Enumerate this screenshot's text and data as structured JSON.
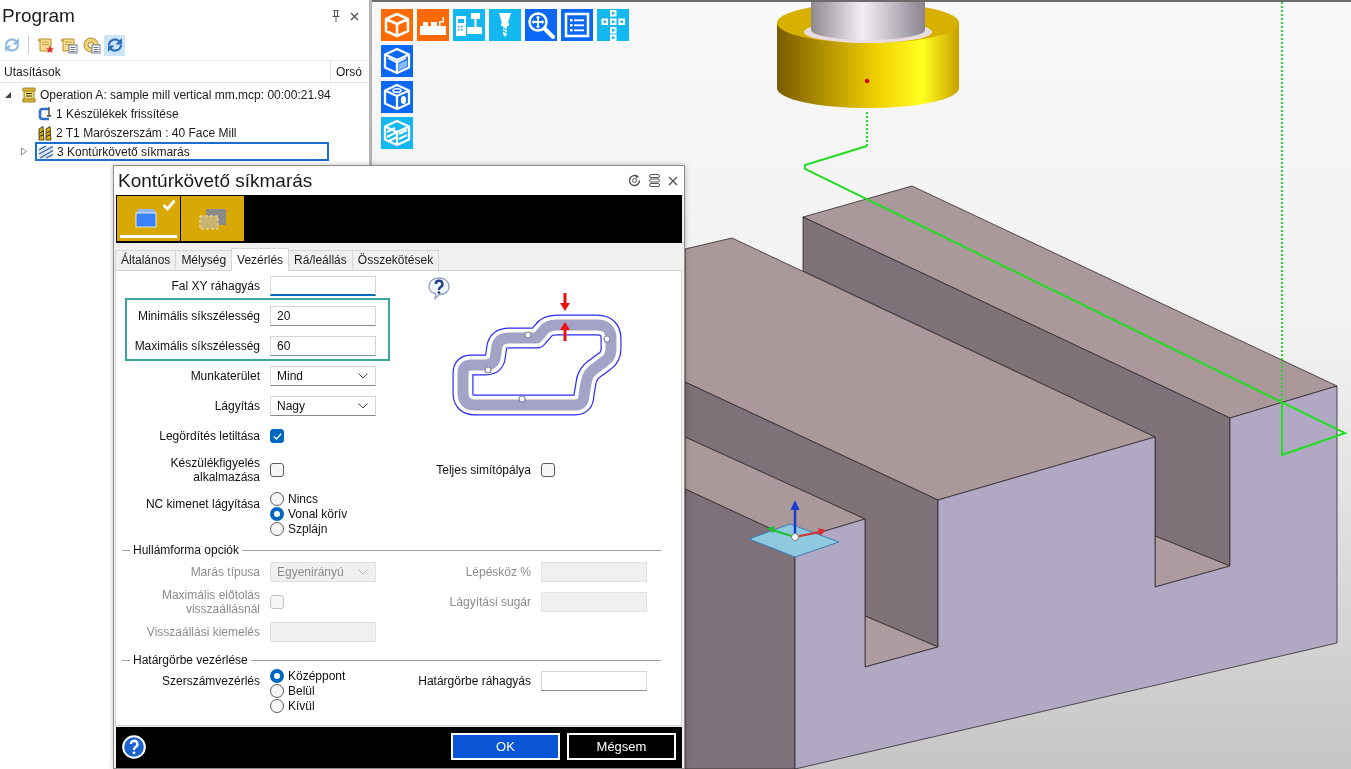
{
  "program_panel": {
    "title": "Program",
    "toolbar": [
      {
        "selected": false
      },
      {
        "selected": false
      },
      {
        "selected": false
      },
      {
        "selected": false
      },
      {
        "selected": true
      }
    ],
    "columns": [
      "Utasítások",
      "Orsó"
    ],
    "tree": [
      {
        "label": "Operation A: sample mill vertical mm.mcp: 00:00:21.94",
        "kind": "operation",
        "expanded": true,
        "selected": false,
        "children": [
          {
            "label": "1 Készülékek frissítése",
            "kind": "fixture",
            "selected": false
          },
          {
            "label": "2 T1 Marószerszám : 40 Face Mill",
            "kind": "tool",
            "selected": false
          },
          {
            "label": "3 Kontúrkövető síkmarás",
            "kind": "toolpath",
            "expanded": false,
            "selected": true
          }
        ]
      }
    ]
  },
  "dialog": {
    "title": "Kontúrkövető síkmarás",
    "pages": [
      {
        "selected": true,
        "checked": true
      },
      {
        "selected": false,
        "checked": false
      }
    ],
    "tabs": [
      {
        "label": "Általános",
        "selected": false
      },
      {
        "label": "Mélység",
        "selected": false
      },
      {
        "label": "Vezérlés",
        "selected": true
      },
      {
        "label": "Rá/leállás",
        "selected": false
      },
      {
        "label": "Összekötések",
        "selected": false
      }
    ],
    "sections": [
      {
        "rows": [
          {
            "left": {
              "kind": "input",
              "label": "Fal XY ráhagyás",
              "focused": true,
              "highlighted": false,
              "disabled": false
            }
          },
          {
            "left": {
              "kind": "input",
              "label": "Minimális síkszélesség",
              "value": "20",
              "focused": false,
              "highlighted": true,
              "disabled": false
            }
          },
          {
            "left": {
              "kind": "input",
              "label": "Maximális síkszélesség",
              "value": "60",
              "focused": false,
              "highlighted": true,
              "disabled": false
            }
          },
          {
            "left": {
              "kind": "dropdown",
              "label": "Munkaterület",
              "value": "Mind",
              "focused": false,
              "highlighted": false,
              "disabled": false
            }
          },
          {
            "left": {
              "kind": "dropdown",
              "label": "Lágyítás",
              "value": "Nagy",
              "focused": false,
              "highlighted": false,
              "disabled": false
            }
          },
          {
            "left": {
              "kind": "checkbox",
              "label": "Legördítés letiltása",
              "checked": true,
              "highlighted": false,
              "disabled": false
            }
          },
          {
            "left": {
              "kind": "checkbox",
              "label": "Készülékfigyelés alkalmazása",
              "checked": false,
              "highlighted": false,
              "disabled": false
            },
            "right": {
              "kind": "checkbox",
              "label": "Teljes simítópálya",
              "checked": false,
              "highlighted": false,
              "disabled": false
            }
          },
          {
            "left": {
              "kind": "radio",
              "label": "NC kimenet lágyítása",
              "highlighted": false,
              "disabled": false,
              "options": [
                {
                  "label": "Nincs",
                  "selected": false
                },
                {
                  "label": "Vonal körív",
                  "selected": true
                },
                {
                  "label": "Szplájn",
                  "selected": false
                }
              ]
            }
          }
        ]
      },
      {
        "title": "Hullámforma opciók",
        "rows": [
          {
            "left": {
              "kind": "dropdown",
              "label": "Marás típusa",
              "value": "Egyenirányú",
              "focused": false,
              "highlighted": false,
              "disabled": true
            },
            "right": {
              "kind": "input",
              "label": "Lépésköz %",
              "focused": false,
              "highlighted": false,
              "disabled": true
            }
          },
          {
            "left": {
              "kind": "checkbox",
              "label": "Maximális előtolás visszaállásnál",
              "checked": false,
              "highlighted": false,
              "disabled": true
            },
            "right": {
              "kind": "input",
              "label": "Lágyítási sugár",
              "focused": false,
              "highlighted": false,
              "disabled": true
            }
          },
          {
            "left": {
              "kind": "input",
              "label": "Visszaállási kiemelés",
              "focused": false,
              "highlighted": false,
              "disabled": true
            }
          }
        ]
      },
      {
        "title": "Határgörbe vezérlése",
        "rows": [
          {
            "left": {
              "kind": "radio",
              "label": "Szerszámvezérlés",
              "highlighted": false,
              "disabled": false,
              "options": [
                {
                  "label": "Középpont",
                  "selected": true
                },
                {
                  "label": "Belül",
                  "selected": false
                },
                {
                  "label": "Kívül",
                  "selected": false
                }
              ]
            },
            "right": {
              "kind": "input",
              "label": "Határgörbe ráhagyás",
              "focused": false,
              "highlighted": false,
              "disabled": false
            }
          }
        ]
      }
    ],
    "buttons": [
      {
        "label": "OK",
        "kind": "primary"
      },
      {
        "label": "Mégsem",
        "kind": "secondary"
      }
    ]
  }
}
